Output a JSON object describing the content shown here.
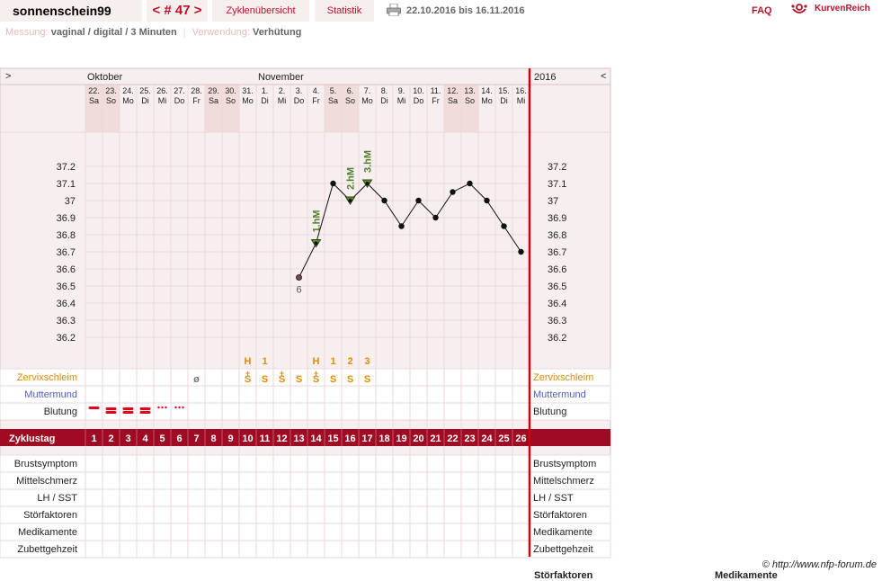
{
  "header": {
    "username": "sonnenschein99",
    "cycle_nav": "< # 47 >",
    "tabs": {
      "cycles": "Zyklenübersicht",
      "stats": "Statistik"
    },
    "date_range": "22.10.2016 bis 16.11.2016",
    "faq": "FAQ",
    "brand": "KurvenReich"
  },
  "meta": {
    "measurement_label": "Messung:",
    "measurement_value": "vaginal / digital / 3 Minuten",
    "usage_label": "Verwendung:",
    "usage_value": "Verhütung"
  },
  "chart_nav": {
    "left": ">",
    "right": "<",
    "year": "2016"
  },
  "months": [
    {
      "name": "Oktober",
      "start_day": 0
    },
    {
      "name": "November",
      "start_day": 10
    }
  ],
  "days": [
    {
      "date": "22.",
      "wd": "Sa"
    },
    {
      "date": "23.",
      "wd": "So"
    },
    {
      "date": "24.",
      "wd": "Mo"
    },
    {
      "date": "25.",
      "wd": "Di"
    },
    {
      "date": "26.",
      "wd": "Mi"
    },
    {
      "date": "27.",
      "wd": "Do"
    },
    {
      "date": "28.",
      "wd": "Fr"
    },
    {
      "date": "29.",
      "wd": "Sa"
    },
    {
      "date": "30.",
      "wd": "So"
    },
    {
      "date": "31.",
      "wd": "Mo"
    },
    {
      "date": "1.",
      "wd": "Di"
    },
    {
      "date": "2.",
      "wd": "Mi"
    },
    {
      "date": "3.",
      "wd": "Do"
    },
    {
      "date": "4.",
      "wd": "Fr"
    },
    {
      "date": "5.",
      "wd": "Sa"
    },
    {
      "date": "6.",
      "wd": "So"
    },
    {
      "date": "7.",
      "wd": "Mo"
    },
    {
      "date": "8.",
      "wd": "Di"
    },
    {
      "date": "9.",
      "wd": "Mi"
    },
    {
      "date": "10.",
      "wd": "Do"
    },
    {
      "date": "11.",
      "wd": "Fr"
    },
    {
      "date": "12.",
      "wd": "Sa"
    },
    {
      "date": "13.",
      "wd": "So"
    },
    {
      "date": "14.",
      "wd": "Mo"
    },
    {
      "date": "15.",
      "wd": "Di"
    },
    {
      "date": "16.",
      "wd": "Mi"
    }
  ],
  "weekend_shaded": [
    0,
    1,
    7,
    8,
    14,
    15,
    21,
    22
  ],
  "y_ticks": [
    "37.2",
    "37.1",
    "37",
    "36.9",
    "36.8",
    "36.7",
    "36.6",
    "36.5",
    "36.4",
    "36.3",
    "36.2"
  ],
  "chart_data": {
    "type": "line",
    "ylim": [
      36.2,
      37.2
    ],
    "points": [
      {
        "day": 13,
        "temp": 36.55,
        "style": "first",
        "label": "6"
      },
      {
        "day": 14,
        "temp": 36.75,
        "style": "hm",
        "hm": "1.hM"
      },
      {
        "day": 15,
        "temp": 37.1,
        "style": "dot"
      },
      {
        "day": 16,
        "temp": 37.0,
        "style": "hm",
        "hm": "2.hM"
      },
      {
        "day": 17,
        "temp": 37.1,
        "style": "hm",
        "hm": "3.hM"
      },
      {
        "day": 18,
        "temp": 37.0,
        "style": "dot"
      },
      {
        "day": 19,
        "temp": 36.85,
        "style": "dot"
      },
      {
        "day": 20,
        "temp": 37.0,
        "style": "dot"
      },
      {
        "day": 21,
        "temp": 36.9,
        "style": "dot"
      },
      {
        "day": 22,
        "temp": 37.05,
        "style": "dot"
      },
      {
        "day": 23,
        "temp": 37.1,
        "style": "dot"
      },
      {
        "day": 24,
        "temp": 37.0,
        "style": "dot"
      },
      {
        "day": 25,
        "temp": 36.85,
        "style": "dot"
      },
      {
        "day": 26,
        "temp": 36.7,
        "style": "dot"
      }
    ]
  },
  "peak_markers": [
    {
      "day": 10,
      "text": "H"
    },
    {
      "day": 11,
      "text": "1"
    },
    {
      "day": 14,
      "text": "H"
    },
    {
      "day": 15,
      "text": "1"
    },
    {
      "day": 16,
      "text": "2"
    },
    {
      "day": 17,
      "text": "3"
    }
  ],
  "cervical": [
    {
      "day": 7,
      "text": "ø",
      "color": "#777"
    },
    {
      "day": 10,
      "text": "S+",
      "color": "#e08a00"
    },
    {
      "day": 11,
      "text": "S",
      "color": "#e08a00"
    },
    {
      "day": 12,
      "text": "S+",
      "color": "#e08a00"
    },
    {
      "day": 13,
      "text": "S",
      "color": "#e08a00"
    },
    {
      "day": 14,
      "text": "S+",
      "color": "#e08a00"
    },
    {
      "day": 15,
      "text": "S",
      "color": "#e08a00"
    },
    {
      "day": 16,
      "text": "S",
      "color": "#e08a00"
    },
    {
      "day": 17,
      "text": "S",
      "color": "#e08a00"
    }
  ],
  "bleeding": [
    {
      "day": 1,
      "level": "one"
    },
    {
      "day": 2,
      "level": "two"
    },
    {
      "day": 3,
      "level": "two"
    },
    {
      "day": 4,
      "level": "two"
    },
    {
      "day": 5,
      "level": "dots"
    },
    {
      "day": 6,
      "level": "dots"
    }
  ],
  "rows": {
    "zervix": "Zervixschleim",
    "muttermund": "Muttermund",
    "blutung": "Blutung",
    "zyklustag": "Zyklustag",
    "lower": [
      "Brustsymptom",
      "Mittelschmerz",
      "LH / SST",
      "Störfaktoren",
      "Medikamente",
      "Zubettgehzeit"
    ]
  },
  "cycle_days": [
    "1",
    "2",
    "3",
    "4",
    "5",
    "6",
    "7",
    "8",
    "9",
    "10",
    "11",
    "12",
    "13",
    "14",
    "15",
    "16",
    "17",
    "18",
    "19",
    "20",
    "21",
    "22",
    "23",
    "24",
    "25",
    "26"
  ],
  "colors": {
    "accent": "#b8122a",
    "cycle_bar": "#9e0b22",
    "hm_green": "#4f7f2a",
    "zervix": "#e08a00",
    "muttermund": "#5060b0"
  },
  "footer": {
    "copyright": "© http://www.nfp-forum.de",
    "cut_1": "Störfaktoren",
    "cut_2": "Medikamente"
  }
}
